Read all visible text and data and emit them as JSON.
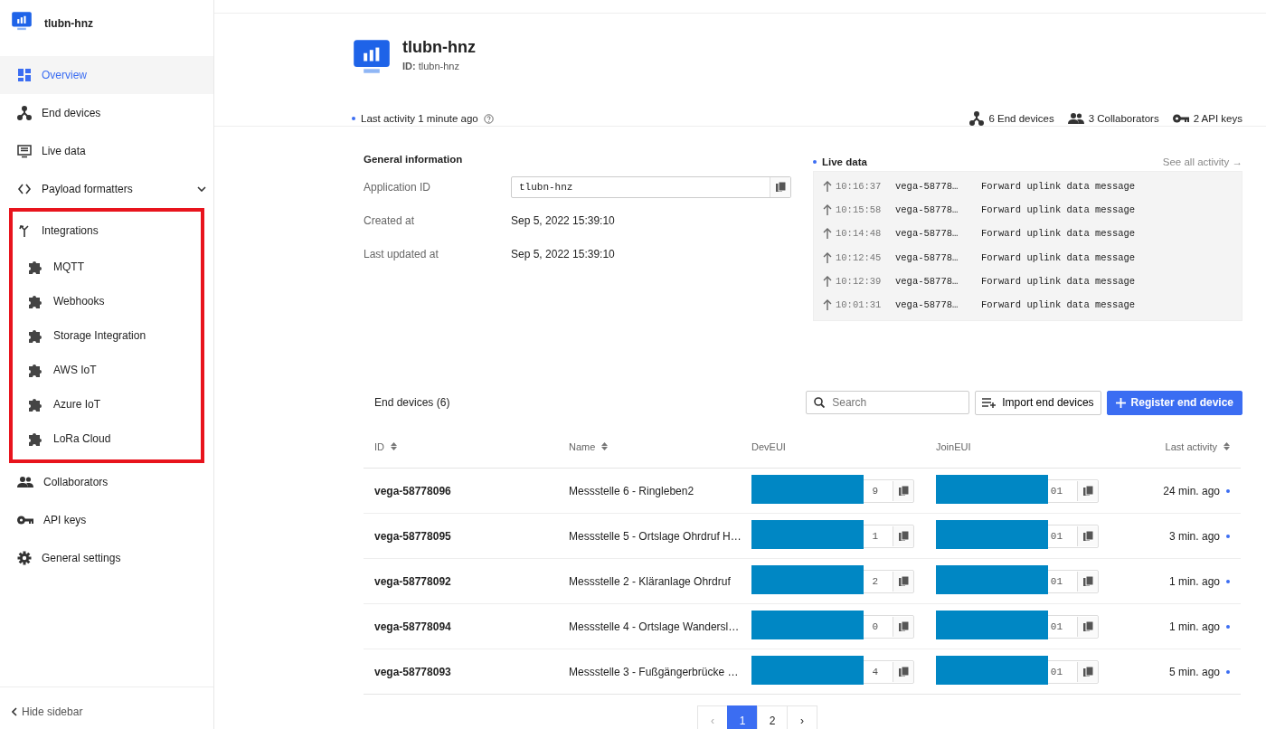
{
  "sidebar": {
    "app_name": "tlubn-hnz",
    "items": [
      {
        "label": "Overview",
        "selected": true
      },
      {
        "label": "End devices",
        "selected": false
      },
      {
        "label": "Live data",
        "selected": false
      },
      {
        "label": "Payload formatters",
        "selected": false,
        "expanded": false
      },
      {
        "label": "Integrations",
        "selected": false,
        "highlighted": true,
        "children": [
          {
            "label": "MQTT",
            "selected": false
          },
          {
            "label": "Webhooks",
            "selected": false
          },
          {
            "label": "Storage Integration",
            "selected": false
          },
          {
            "label": "AWS IoT",
            "selected": false
          },
          {
            "label": "Azure IoT",
            "selected": false
          },
          {
            "label": "LoRa Cloud",
            "selected": false
          }
        ]
      },
      {
        "label": "Collaborators",
        "selected": false
      },
      {
        "label": "API keys",
        "selected": false
      },
      {
        "label": "General settings",
        "selected": false
      }
    ],
    "hide_sidebar": "Hide sidebar"
  },
  "header": {
    "title": "tlubn-hnz",
    "id_label": "ID:",
    "id_value": "tlubn-hnz",
    "last_activity": "Last activity 1 minute ago",
    "stats": [
      "6 End devices",
      "3 Collaborators",
      "2 API keys"
    ]
  },
  "general_information": {
    "title": "General information",
    "fields": [
      {
        "label": "Application ID",
        "value": "tlubn-hnz",
        "kind": "copy"
      },
      {
        "label": "Created at",
        "value": "Sep 5, 2022 15:39:10",
        "kind": "text"
      },
      {
        "label": "Last updated at",
        "value": "Sep 5, 2022 15:39:10",
        "kind": "text"
      }
    ]
  },
  "live_data": {
    "title": "Live data",
    "link": "See all activity →",
    "events": [
      {
        "time": "10:16:37",
        "device": "vega-58778…",
        "message": "Forward uplink data message"
      },
      {
        "time": "10:15:58",
        "device": "vega-58778…",
        "message": "Forward uplink data message"
      },
      {
        "time": "10:14:48",
        "device": "vega-58778…",
        "message": "Forward uplink data message"
      },
      {
        "time": "10:12:45",
        "device": "vega-58778…",
        "message": "Forward uplink data message"
      },
      {
        "time": "10:12:39",
        "device": "vega-58778…",
        "message": "Forward uplink data message"
      },
      {
        "time": "10:01:31",
        "device": "vega-58778…",
        "message": "Forward uplink data message"
      }
    ]
  },
  "end_devices": {
    "title": "End devices (6)",
    "search_placeholder": "Search",
    "import_button": "Import end devices",
    "register_button": "Register end device",
    "columns": [
      {
        "label": "ID",
        "sortable": true
      },
      {
        "label": "Name",
        "sortable": true
      },
      {
        "label": "DevEUI",
        "sortable": false
      },
      {
        "label": "JoinEUI",
        "sortable": false
      },
      {
        "label": "Last activity",
        "sortable": true
      }
    ],
    "rows": [
      {
        "id": "vega-58778096",
        "name": "Messstelle 6 - Ringleben2",
        "dev_eui": "9",
        "join_eui": "01",
        "last_activity": "24 min. ago"
      },
      {
        "id": "vega-58778095",
        "name": "Messstelle 5 - Ortslage Ohrdruf H…",
        "dev_eui": "1",
        "join_eui": "01",
        "last_activity": "3 min. ago"
      },
      {
        "id": "vega-58778092",
        "name": "Messstelle 2 - Kläranlage Ohrdruf",
        "dev_eui": "2",
        "join_eui": "01",
        "last_activity": "1 min. ago"
      },
      {
        "id": "vega-58778094",
        "name": "Messstelle 4 - Ortslage Wandersl…",
        "dev_eui": "0",
        "join_eui": "01",
        "last_activity": "1 min. ago"
      },
      {
        "id": "vega-58778093",
        "name": "Messstelle 3 - Fußgängerbrücke …",
        "dev_eui": "4",
        "join_eui": "01",
        "last_activity": "5 min. ago"
      }
    ]
  },
  "pagination": {
    "previous": "‹",
    "next": "›",
    "pages": [
      {
        "label": "1",
        "selected": true
      },
      {
        "label": "2",
        "selected": false
      }
    ]
  }
}
